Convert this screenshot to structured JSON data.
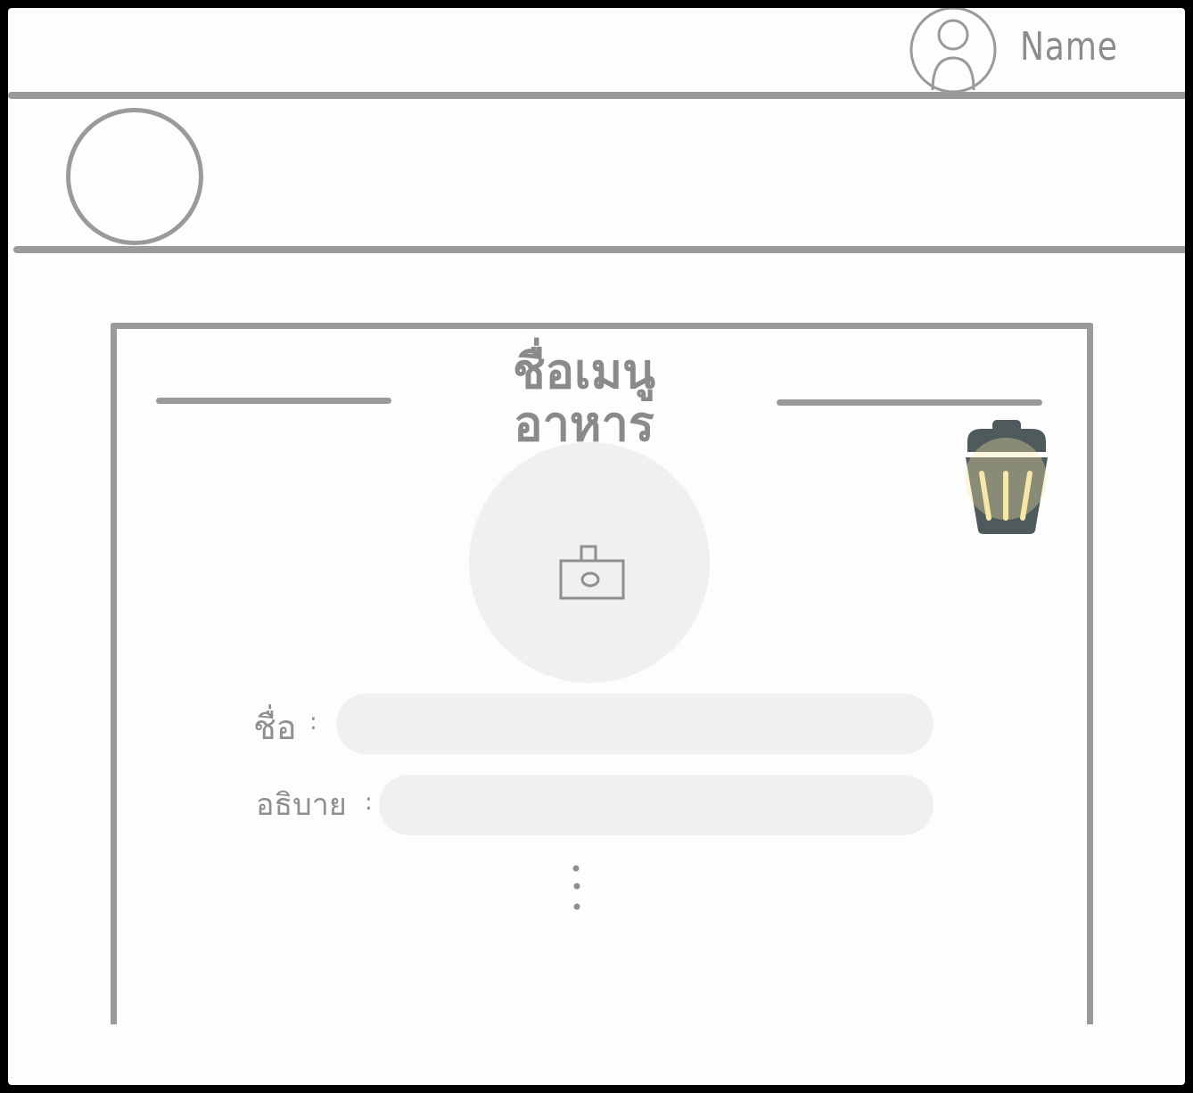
{
  "header": {
    "user_name": "Name"
  },
  "card": {
    "title": "ชื่อเมนูอาหาร",
    "fields": [
      {
        "label": "ชื่อ",
        "separator": ":",
        "value": ""
      },
      {
        "label": "อธิบาย",
        "separator": ":",
        "value": ""
      }
    ]
  },
  "icons": {
    "avatar": "user-avatar-icon",
    "logo": "logo-placeholder-circle",
    "photo": "camera-icon",
    "delete": "trash-icon",
    "more": "vertical-ellipsis-icon"
  },
  "colors": {
    "line": "#9a9a9a",
    "pill": "#f1efef",
    "trash_body": "#4f5a5c",
    "trash_highlight": "#f6e8a8"
  }
}
